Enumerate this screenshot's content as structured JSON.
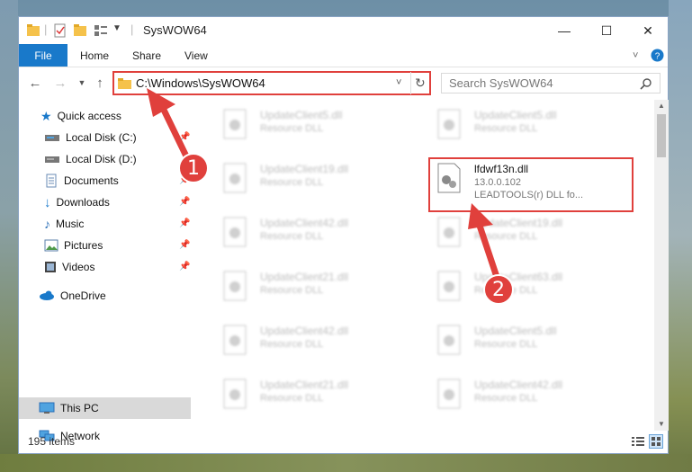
{
  "window": {
    "title": "SysWOW64",
    "minimize": "—",
    "maximize": "☐",
    "close": "✕"
  },
  "ribbon": {
    "tabs": [
      "File",
      "Home",
      "Share",
      "View"
    ]
  },
  "address": {
    "path": "C:\\Windows\\SysWOW64"
  },
  "search": {
    "placeholder": "Search SysWOW64"
  },
  "nav": {
    "items": [
      {
        "label": "Quick access",
        "icon": "star-icon"
      },
      {
        "label": "Local Disk (C:)",
        "icon": "drive-icon"
      },
      {
        "label": "Local Disk (D:)",
        "icon": "drive-icon"
      },
      {
        "label": "Documents",
        "icon": "documents-icon"
      },
      {
        "label": "Downloads",
        "icon": "download-icon"
      },
      {
        "label": "Music",
        "icon": "music-icon"
      },
      {
        "label": "Pictures",
        "icon": "pictures-icon"
      },
      {
        "label": "Videos",
        "icon": "videos-icon"
      },
      {
        "label": "OneDrive",
        "icon": "cloud-icon"
      },
      {
        "label": "This PC",
        "icon": "computer-icon"
      },
      {
        "label": "Network",
        "icon": "network-icon"
      }
    ]
  },
  "files": [
    {
      "name": "UpdateClient5.dll",
      "desc": "Resource DLL"
    },
    {
      "name": "UpdateClient5.dll",
      "desc": "Resource DLL"
    },
    {
      "name": "UpdateClient19.dll",
      "desc": "Resource DLL"
    },
    {
      "name": "UpdateClient42.dll",
      "desc": "Resource DLL"
    },
    {
      "name": "UpdateClient19.dll",
      "desc": "Resource DLL"
    },
    {
      "name": "UpdateClient21.dll",
      "desc": "Resource DLL"
    },
    {
      "name": "UpdateClient63.dll",
      "desc": "Resource DLL"
    },
    {
      "name": "UpdateClient42.dll",
      "desc": "Resource DLL"
    },
    {
      "name": "UpdateClient5.dll",
      "desc": "Resource DLL"
    },
    {
      "name": "UpdateClient21.dll",
      "desc": "Resource DLL"
    },
    {
      "name": "UpdateClient42.dll",
      "desc": "Resource DLL"
    }
  ],
  "target_file": {
    "name": "lfdwf13n.dll",
    "version": "13.0.0.102",
    "desc": "LEADTOOLS(r) DLL fo..."
  },
  "status": {
    "count": "195 items"
  },
  "callouts": [
    "1",
    "2"
  ],
  "colors": {
    "accent": "#1979ca",
    "highlight": "#e0403c"
  }
}
